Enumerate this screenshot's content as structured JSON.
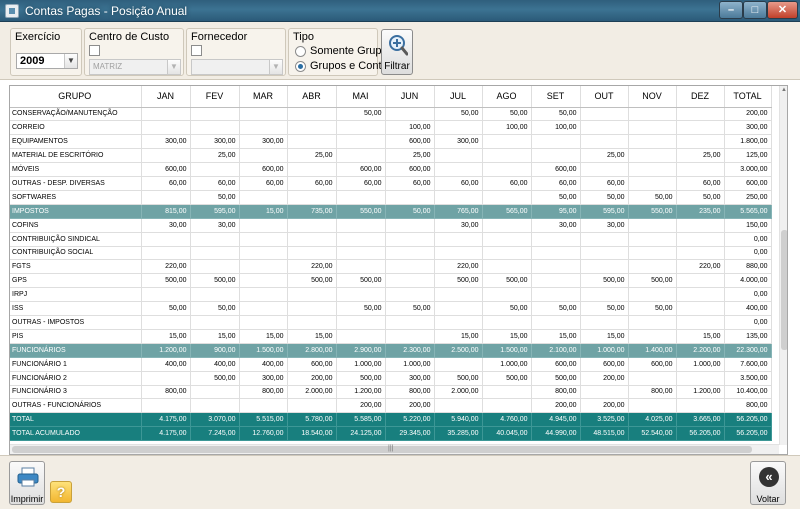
{
  "window": {
    "title": "Contas Pagas - Posição Anual"
  },
  "filters": {
    "exercicio": {
      "label": "Exercício",
      "value": "2009"
    },
    "centro_custo": {
      "label": "Centro de Custo",
      "value": "MATRIZ"
    },
    "fornecedor": {
      "label": "Fornecedor",
      "value": ""
    },
    "tipo": {
      "label": "Tipo",
      "opt1": "Somente Grupos",
      "opt2": "Grupos e Contas",
      "selected": "Grupos e Contas"
    },
    "filtrar_label": "Filtrar"
  },
  "grid": {
    "columns": [
      "GRUPO",
      "JAN",
      "FEV",
      "MAR",
      "ABR",
      "MAI",
      "JUN",
      "JUL",
      "AGO",
      "SET",
      "OUT",
      "NOV",
      "DEZ",
      "TOTAL"
    ],
    "rows": [
      {
        "type": "item",
        "cells": [
          "CONSERVAÇÃO/MANUTENÇÃO",
          "",
          "",
          "",
          "",
          "50,00",
          "",
          "50,00",
          "50,00",
          "50,00",
          "",
          "",
          "",
          "200,00"
        ]
      },
      {
        "type": "item",
        "cells": [
          "CORREIO",
          "",
          "",
          "",
          "",
          "",
          "100,00",
          "",
          "100,00",
          "100,00",
          "",
          "",
          "",
          "300,00"
        ]
      },
      {
        "type": "item",
        "cells": [
          "EQUIPAMENTOS",
          "300,00",
          "300,00",
          "300,00",
          "",
          "",
          "600,00",
          "300,00",
          "",
          "",
          "",
          "",
          "",
          "1.800,00"
        ]
      },
      {
        "type": "item",
        "cells": [
          "MATERIAL DE ESCRITÓRIO",
          "",
          "25,00",
          "",
          "25,00",
          "",
          "25,00",
          "",
          "",
          "",
          "25,00",
          "",
          "25,00",
          "125,00"
        ]
      },
      {
        "type": "item",
        "cells": [
          "MÓVEIS",
          "600,00",
          "",
          "600,00",
          "",
          "600,00",
          "600,00",
          "",
          "",
          "600,00",
          "",
          "",
          "",
          "3.000,00"
        ]
      },
      {
        "type": "item",
        "cells": [
          "OUTRAS - DESP. DIVERSAS",
          "60,00",
          "60,00",
          "60,00",
          "60,00",
          "60,00",
          "60,00",
          "60,00",
          "60,00",
          "60,00",
          "60,00",
          "",
          "60,00",
          "600,00"
        ]
      },
      {
        "type": "item",
        "cells": [
          "SOFTWARES",
          "",
          "50,00",
          "",
          "",
          "",
          "",
          "",
          "",
          "50,00",
          "50,00",
          "50,00",
          "50,00",
          "250,00"
        ]
      },
      {
        "type": "group",
        "cells": [
          "IMPOSTOS",
          "815,00",
          "595,00",
          "15,00",
          "735,00",
          "550,00",
          "50,00",
          "765,00",
          "565,00",
          "95,00",
          "595,00",
          "550,00",
          "235,00",
          "5.565,00"
        ]
      },
      {
        "type": "item",
        "cells": [
          "COFINS",
          "30,00",
          "30,00",
          "",
          "",
          "",
          "",
          "30,00",
          "",
          "30,00",
          "30,00",
          "",
          "",
          "150,00"
        ]
      },
      {
        "type": "item",
        "cells": [
          "CONTRIBUIÇÃO SINDICAL",
          "",
          "",
          "",
          "",
          "",
          "",
          "",
          "",
          "",
          "",
          "",
          "",
          "0,00"
        ]
      },
      {
        "type": "item",
        "cells": [
          "CONTRIBUIÇÃO SOCIAL",
          "",
          "",
          "",
          "",
          "",
          "",
          "",
          "",
          "",
          "",
          "",
          "",
          "0,00"
        ]
      },
      {
        "type": "item",
        "cells": [
          "FGTS",
          "220,00",
          "",
          "",
          "220,00",
          "",
          "",
          "220,00",
          "",
          "",
          "",
          "",
          "220,00",
          "880,00"
        ]
      },
      {
        "type": "item",
        "cells": [
          "GPS",
          "500,00",
          "500,00",
          "",
          "500,00",
          "500,00",
          "",
          "500,00",
          "500,00",
          "",
          "500,00",
          "500,00",
          "",
          "4.000,00"
        ]
      },
      {
        "type": "item",
        "cells": [
          "IRPJ",
          "",
          "",
          "",
          "",
          "",
          "",
          "",
          "",
          "",
          "",
          "",
          "",
          "0,00"
        ]
      },
      {
        "type": "item",
        "cells": [
          "ISS",
          "50,00",
          "50,00",
          "",
          "",
          "50,00",
          "50,00",
          "",
          "50,00",
          "50,00",
          "50,00",
          "50,00",
          "",
          "400,00"
        ]
      },
      {
        "type": "item",
        "cells": [
          "OUTRAS - IMPOSTOS",
          "",
          "",
          "",
          "",
          "",
          "",
          "",
          "",
          "",
          "",
          "",
          "",
          "0,00"
        ]
      },
      {
        "type": "item",
        "cells": [
          "PIS",
          "15,00",
          "15,00",
          "15,00",
          "15,00",
          "",
          "",
          "15,00",
          "15,00",
          "15,00",
          "15,00",
          "",
          "15,00",
          "135,00"
        ]
      },
      {
        "type": "group",
        "cells": [
          "FUNCIONÁRIOS",
          "1.200,00",
          "900,00",
          "1.500,00",
          "2.800,00",
          "2.900,00",
          "2.300,00",
          "2.500,00",
          "1.500,00",
          "2.100,00",
          "1.000,00",
          "1.400,00",
          "2.200,00",
          "22.300,00"
        ]
      },
      {
        "type": "item",
        "cells": [
          "FUNCIONÁRIO 1",
          "400,00",
          "400,00",
          "400,00",
          "600,00",
          "1.000,00",
          "1.000,00",
          "",
          "1.000,00",
          "600,00",
          "600,00",
          "600,00",
          "1.000,00",
          "7.600,00"
        ]
      },
      {
        "type": "item",
        "cells": [
          "FUNCIONÁRIO 2",
          "",
          "500,00",
          "300,00",
          "200,00",
          "500,00",
          "300,00",
          "500,00",
          "500,00",
          "500,00",
          "200,00",
          "",
          "",
          "3.500,00"
        ]
      },
      {
        "type": "item",
        "cells": [
          "FUNCIONÁRIO 3",
          "800,00",
          "",
          "800,00",
          "2.000,00",
          "1.200,00",
          "800,00",
          "2.000,00",
          "",
          "800,00",
          "",
          "800,00",
          "1.200,00",
          "10.400,00"
        ]
      },
      {
        "type": "item",
        "cells": [
          "OUTRAS - FUNCIONÁRIOS",
          "",
          "",
          "",
          "",
          "200,00",
          "200,00",
          "",
          "",
          "200,00",
          "200,00",
          "",
          "",
          "800,00"
        ]
      },
      {
        "type": "total",
        "cells": [
          "TOTAL",
          "4.175,00",
          "3.070,00",
          "5.515,00",
          "5.780,00",
          "5.585,00",
          "5.220,00",
          "5.940,00",
          "4.760,00",
          "4.945,00",
          "3.525,00",
          "4.025,00",
          "3.665,00",
          "56.205,00"
        ]
      },
      {
        "type": "total",
        "cells": [
          "TOTAL ACUMULADO",
          "4.175,00",
          "7.245,00",
          "12.760,00",
          "18.540,00",
          "24.125,00",
          "29.345,00",
          "35.285,00",
          "40.045,00",
          "44.990,00",
          "48.515,00",
          "52.540,00",
          "56.205,00",
          "56.205,00"
        ]
      }
    ]
  },
  "bottom": {
    "imprimir_label": "Imprimir",
    "voltar_label": "Voltar",
    "help_glyph": "?",
    "back_glyph": "«"
  },
  "colors": {
    "group_row": "#6fa3a5",
    "total_row": "#187f7e"
  }
}
